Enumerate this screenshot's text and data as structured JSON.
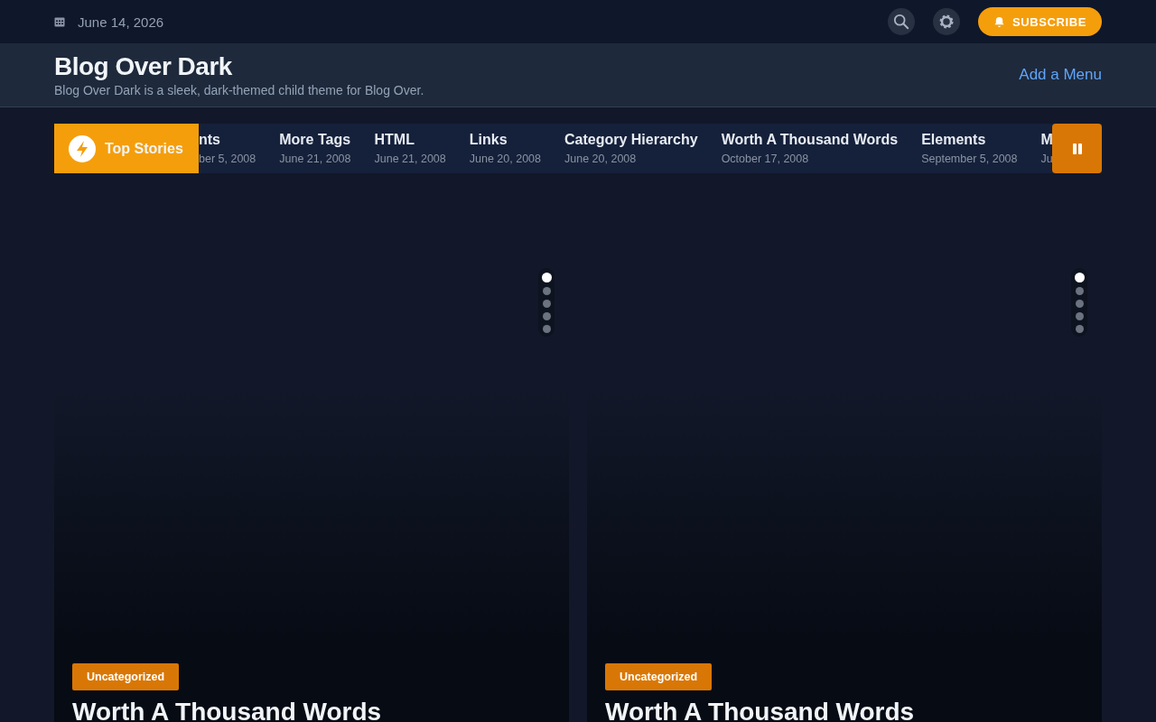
{
  "topbar": {
    "date": "June 14, 2026",
    "subscribe": "SUBSCRIBE"
  },
  "header": {
    "title": "Blog Over Dark",
    "tagline": "Blog Over Dark is a sleek, dark-themed child theme for Blog Over.",
    "menu_link": "Add a Menu"
  },
  "ticker": {
    "label": "Top Stories",
    "paused": false,
    "items": [
      {
        "title": "nts",
        "date": "ber 5, 2008"
      },
      {
        "title": "More Tags",
        "date": "June 21, 2008"
      },
      {
        "title": "HTML",
        "date": "June 21, 2008"
      },
      {
        "title": "Links",
        "date": "June 20, 2008"
      },
      {
        "title": "Category Hierarchy",
        "date": "June 20, 2008"
      },
      {
        "title": "Worth A Thousand Words",
        "date": "October 17, 2008"
      },
      {
        "title": "Elements",
        "date": "September 5, 2008"
      },
      {
        "title": "M",
        "date": "Ju"
      }
    ]
  },
  "sliders": [
    {
      "dots": [
        {
          "selected": true
        },
        {
          "selected": false
        },
        {
          "selected": false
        },
        {
          "selected": false
        },
        {
          "selected": false
        }
      ],
      "category": "Uncategorized",
      "title": "Worth A Thousand Words"
    },
    {
      "dots": [
        {
          "selected": true
        },
        {
          "selected": false
        },
        {
          "selected": false
        },
        {
          "selected": false
        },
        {
          "selected": false
        }
      ],
      "category": "Uncategorized",
      "title": "Worth A Thousand Words"
    }
  ]
}
